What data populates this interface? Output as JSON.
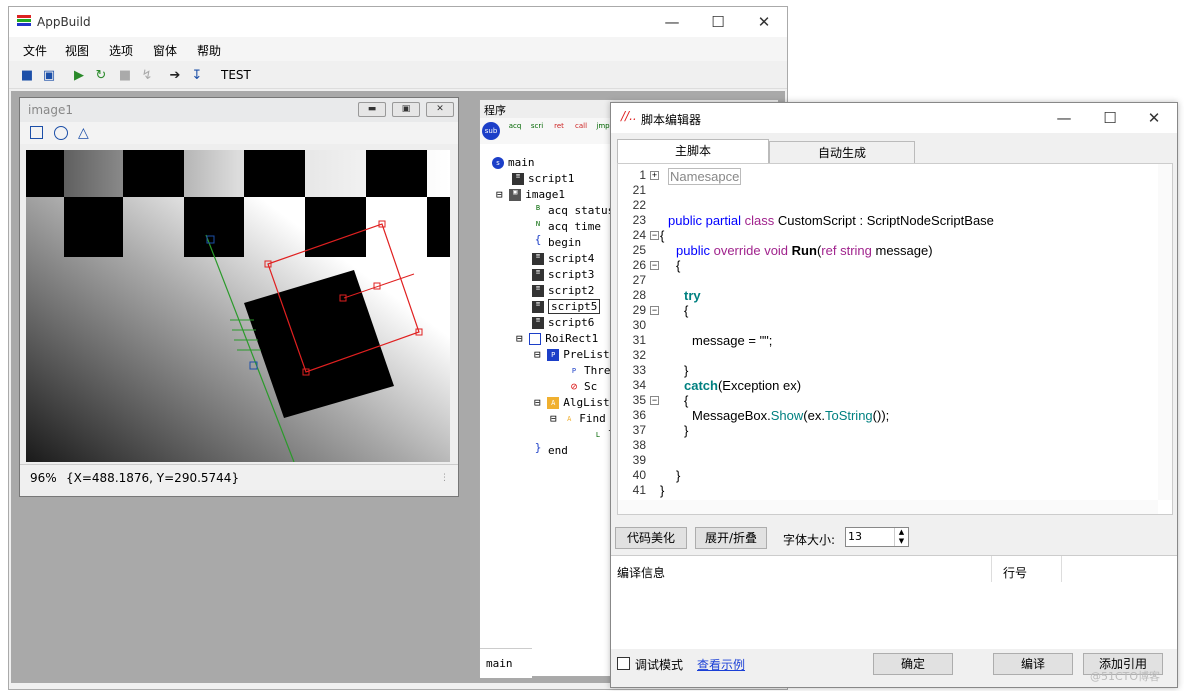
{
  "app": {
    "title": "AppBuild",
    "menu": [
      "文件",
      "视图",
      "选项",
      "窗体",
      "帮助"
    ],
    "toolbar_text": "TEST"
  },
  "image_window": {
    "title": "image1",
    "zoom": "96%",
    "coords": "{X=488.1876, Y=290.5744}"
  },
  "program_panel": {
    "title": "程序",
    "toolbar_labels": [
      "sub",
      "acq",
      "scri",
      "ret",
      "call",
      "jmp"
    ],
    "tree": [
      {
        "icon": "sub",
        "text": "main"
      },
      {
        "icon": "scri",
        "text": "script1"
      },
      {
        "icon": "acq",
        "text": "image1"
      },
      {
        "icon": "B",
        "text": "acq status"
      },
      {
        "icon": "N",
        "text": "acq time"
      },
      {
        "icon": "{",
        "text": "begin"
      },
      {
        "icon": "scri",
        "text": "script4"
      },
      {
        "icon": "scri",
        "text": "script3"
      },
      {
        "icon": "scri",
        "text": "script2"
      },
      {
        "icon": "scri",
        "text": "script5"
      },
      {
        "icon": "scri",
        "text": "script6"
      },
      {
        "icon": "roi",
        "text": "RoiRect1"
      },
      {
        "icon": "Pre",
        "text": "PreList"
      },
      {
        "icon": "Pre",
        "text": "Thre"
      },
      {
        "icon": "Pre",
        "text": "Sc"
      },
      {
        "icon": "Alg",
        "text": "AlgList"
      },
      {
        "icon": "Alg",
        "text": "Find"
      },
      {
        "icon": "L",
        "text": "l"
      },
      {
        "icon": "}",
        "text": "end"
      }
    ],
    "bottom_tab": "main"
  },
  "editor": {
    "title": "脚本编辑器",
    "tabs": [
      "主脚本",
      "自动生成"
    ],
    "code_lines": [
      {
        "n": "1",
        "text": "Namesapce"
      },
      {
        "n": "21",
        "text": ""
      },
      {
        "n": "22",
        "text": ""
      },
      {
        "n": "23",
        "text": "public partial class CustomScript : ScriptNodeScriptBase"
      },
      {
        "n": "24",
        "text": "{"
      },
      {
        "n": "25",
        "text": "public override void Run(ref string message)"
      },
      {
        "n": "26",
        "text": "{"
      },
      {
        "n": "27",
        "text": ""
      },
      {
        "n": "28",
        "text": "try"
      },
      {
        "n": "29",
        "text": "{"
      },
      {
        "n": "30",
        "text": ""
      },
      {
        "n": "31",
        "text": "message = \"\";"
      },
      {
        "n": "32",
        "text": ""
      },
      {
        "n": "33",
        "text": "}"
      },
      {
        "n": "34",
        "text": "catch(Exception ex)"
      },
      {
        "n": "35",
        "text": "{"
      },
      {
        "n": "36",
        "text": "MessageBox.Show(ex.ToString());"
      },
      {
        "n": "37",
        "text": "}"
      },
      {
        "n": "38",
        "text": ""
      },
      {
        "n": "39",
        "text": ""
      },
      {
        "n": "40",
        "text": "}"
      },
      {
        "n": "41",
        "text": "}"
      }
    ],
    "beautify_button": "代码美化",
    "fold_button": "展开/折叠",
    "font_size_label": "字体大小:",
    "font_size_value": "13",
    "info_header": "编译信息",
    "line_header": "行号",
    "debug_mode": "调试模式",
    "view_example": "查看示例",
    "ok_button": "确定",
    "compile_button": "编译",
    "add_ref_button": "添加引用"
  },
  "watermark": "@51CTO博客"
}
